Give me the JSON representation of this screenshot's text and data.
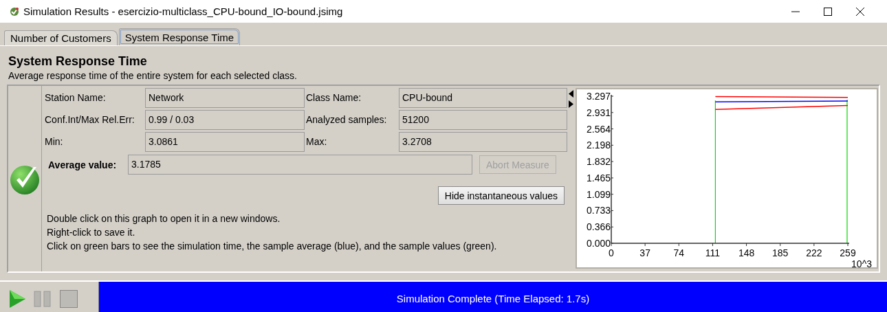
{
  "window": {
    "title": "Simulation Results - esercizio-multiclass_CPU-bound_IO-bound.jsimg"
  },
  "tabs": [
    {
      "label": "Number of Customers",
      "selected": false
    },
    {
      "label": "System Response Time",
      "selected": true
    }
  ],
  "measure": {
    "title": "System Response Time",
    "description": "Average response time of the entire system for each selected class.",
    "fields": [
      {
        "label": "Station Name:",
        "value": "Network"
      },
      {
        "label": "Class Name:",
        "value": "CPU-bound"
      },
      {
        "label": "Conf.Int/Max Rel.Err:",
        "value": "0.99 / 0.03"
      },
      {
        "label": "Analyzed samples:",
        "value": "51200"
      },
      {
        "label": "Min:",
        "value": "3.0861"
      },
      {
        "label": "Max:",
        "value": "3.2708"
      }
    ],
    "average": {
      "label": "Average value:",
      "value": "3.1785"
    },
    "abort_button": {
      "label": "Abort Measure",
      "disabled": true
    },
    "toggle_button": {
      "label": "Hide instantaneous values"
    },
    "help": [
      "Double click on this graph to open it in a new windows.",
      "Right-click to save it.",
      "Click on green bars to see the simulation time, the sample average (blue), and the sample values (green)."
    ],
    "chart_data": {
      "type": "line",
      "xlabel": "10^3",
      "x": [
        114,
        259
      ],
      "xlim": [
        0,
        259
      ],
      "ylim": [
        0,
        3.297
      ],
      "xticks": [
        0,
        37,
        74,
        111,
        148,
        185,
        222,
        259
      ],
      "yticks": [
        {
          "value": 0,
          "label": "0.000"
        },
        {
          "value": 0.366,
          "label": "0.366"
        },
        {
          "value": 0.733,
          "label": "0.733"
        },
        {
          "value": 1.099,
          "label": "1.099"
        },
        {
          "value": 1.465,
          "label": "1.465"
        },
        {
          "value": 1.832,
          "label": "1.832"
        },
        {
          "value": 2.198,
          "label": "2.198"
        },
        {
          "value": 2.564,
          "label": "2.564"
        },
        {
          "value": 2.931,
          "label": "2.931"
        },
        {
          "value": 3.297,
          "label": "3.297"
        }
      ],
      "series": [
        {
          "color": "#ff0000",
          "values": [
            3.29,
            3.27
          ]
        },
        {
          "color": "#0000ff",
          "values": [
            3.17,
            3.19
          ]
        },
        {
          "color": "#ff0000",
          "values": [
            3.0,
            3.09
          ]
        }
      ],
      "ref_lines": [
        {
          "axis": "x",
          "value": 114,
          "color": "#00dd00"
        },
        {
          "axis": "x",
          "value": 259,
          "color": "#00dd00"
        }
      ]
    }
  },
  "status": {
    "text": "Simulation Complete (Time Elapsed: 1.7s)",
    "level": 1
  }
}
